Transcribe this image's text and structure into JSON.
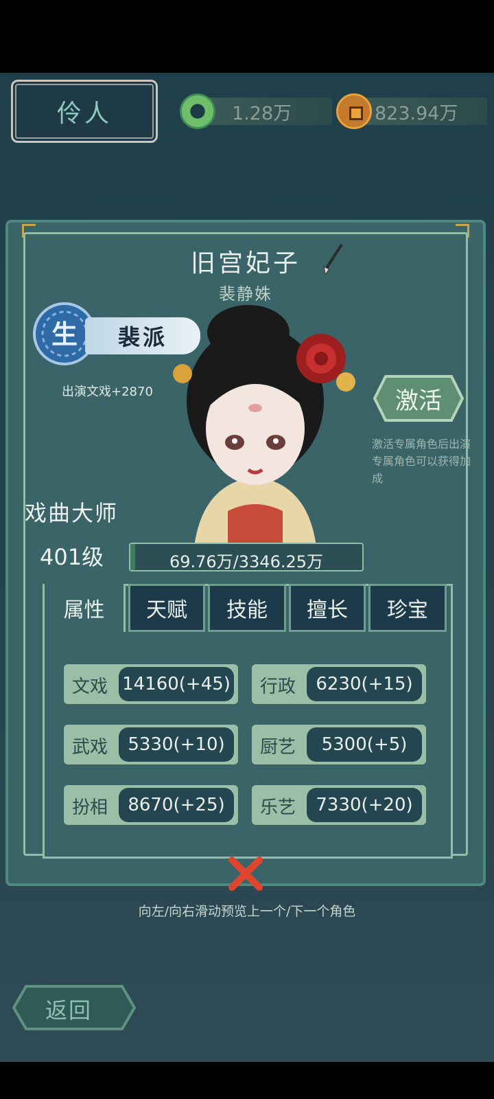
{
  "header": {
    "title": "伶人",
    "currency": [
      {
        "icon": "jade-ring-icon",
        "value": "1.28万"
      },
      {
        "icon": "copper-coin-icon",
        "value": "823.94万"
      }
    ]
  },
  "character": {
    "name": "旧宫妃子",
    "actor_name": "裴静姝",
    "school": {
      "emblem_char": "生",
      "label": "裴派"
    },
    "bonus": "出演文戏+2870",
    "activate_label": "激活",
    "activate_note": "激活专属角色后出演专属角色可以获得加成",
    "rank": "戏曲大师",
    "level": "401级",
    "exp_text": "69.76万/3346.25万",
    "exp_progress": 0.0209
  },
  "tabs": [
    "属性",
    "天赋",
    "技能",
    "擅长",
    "珍宝"
  ],
  "stats": [
    {
      "label": "文戏",
      "value": "14160(+45)"
    },
    {
      "label": "行政",
      "value": "6230(+15)"
    },
    {
      "label": "武戏",
      "value": "5330(+10)"
    },
    {
      "label": "厨艺",
      "value": "5300(+5)"
    },
    {
      "label": "扮相",
      "value": "8670(+25)"
    },
    {
      "label": "乐艺",
      "value": "7330(+20)"
    }
  ],
  "hint": "向左/向右滑动预览上一个/下一个角色",
  "back_label": "返回",
  "colors": {
    "panel": "#3a6468",
    "accent": "#8fc0a6",
    "close": "#e0452f"
  }
}
